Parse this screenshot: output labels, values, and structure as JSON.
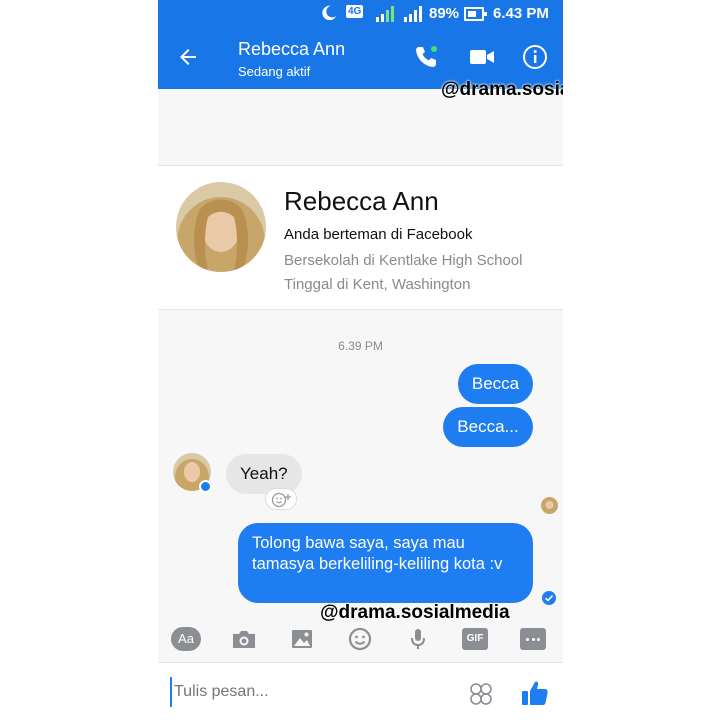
{
  "status_bar": {
    "network": "4G",
    "battery": "89%",
    "time": "6.43 PM"
  },
  "header": {
    "contact_name": "Rebecca Ann",
    "status": "Sedang aktif"
  },
  "watermark": {
    "top": "@drama.sosialmedia",
    "bottom": "@drama.sosialmedia"
  },
  "profile": {
    "name": "Rebecca Ann",
    "friend_note": "Anda berteman di Facebook",
    "school": "Bersekolah di Kentlake High School",
    "location": "Tinggal di Kent, Washington"
  },
  "messages": {
    "timestamp": "6.39 PM",
    "sent_1": "Becca",
    "sent_2": "Becca...",
    "received_1": "Yeah?",
    "sent_3": "Tolong bawa saya, saya mau tamasya berkeliling-keliling kota :v"
  },
  "toolbar": {
    "aa_label": "Aa",
    "gif_label": "GIF"
  },
  "compose": {
    "placeholder": "Tulis pesan..."
  },
  "colors": {
    "brand": "#1976e6",
    "bubble_sent": "#1e7df0",
    "bubble_received": "#e6e6e6"
  },
  "icons": [
    "moon-icon",
    "signal-icon",
    "battery-icon",
    "back-arrow-icon",
    "phone-call-icon",
    "video-call-icon",
    "info-icon",
    "camera-icon",
    "image-icon",
    "emoji-icon",
    "microphone-icon",
    "more-icon",
    "stickers-icon",
    "thumbs-up-icon"
  ]
}
